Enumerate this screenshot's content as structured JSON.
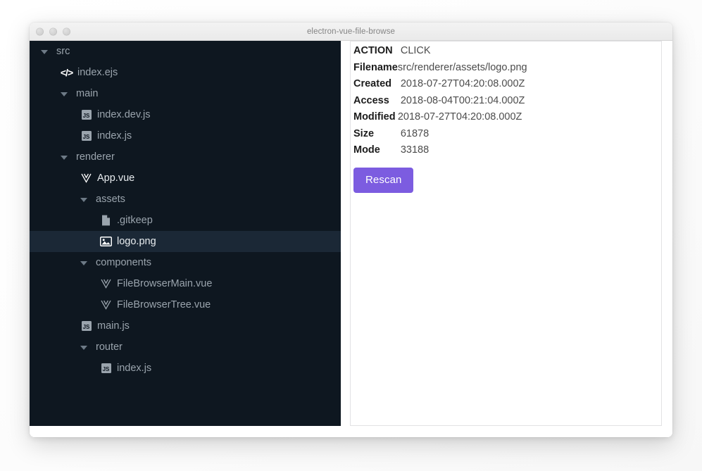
{
  "window": {
    "title": "electron-vue-file-browse",
    "traffic_lights": [
      "close-light",
      "minimize-light",
      "zoom-light"
    ]
  },
  "tree": {
    "items": [
      {
        "label": "src",
        "depth": 0,
        "caret": true,
        "icon": "none",
        "selected": false,
        "bright": false
      },
      {
        "label": "index.ejs",
        "depth": 1,
        "caret": false,
        "icon": "code",
        "selected": false,
        "bright": false
      },
      {
        "label": "main",
        "depth": 1,
        "caret": true,
        "icon": "none",
        "selected": false,
        "bright": false
      },
      {
        "label": "index.dev.js",
        "depth": 2,
        "caret": false,
        "icon": "js",
        "selected": false,
        "bright": false
      },
      {
        "label": "index.js",
        "depth": 2,
        "caret": false,
        "icon": "js",
        "selected": false,
        "bright": false
      },
      {
        "label": "renderer",
        "depth": 1,
        "caret": true,
        "icon": "none",
        "selected": false,
        "bright": false
      },
      {
        "label": "App.vue",
        "depth": 2,
        "caret": false,
        "icon": "vue-white",
        "selected": false,
        "bright": true
      },
      {
        "label": "assets",
        "depth": 2,
        "caret": true,
        "icon": "none",
        "selected": false,
        "bright": false
      },
      {
        "label": ".gitkeep",
        "depth": 3,
        "caret": false,
        "icon": "doc",
        "selected": false,
        "bright": false
      },
      {
        "label": "logo.png",
        "depth": 3,
        "caret": false,
        "icon": "image",
        "selected": true,
        "bright": true
      },
      {
        "label": "components",
        "depth": 2,
        "caret": true,
        "icon": "none",
        "selected": false,
        "bright": false
      },
      {
        "label": "FileBrowserMain.vue",
        "depth": 3,
        "caret": false,
        "icon": "vue-grey",
        "selected": false,
        "bright": false
      },
      {
        "label": "FileBrowserTree.vue",
        "depth": 3,
        "caret": false,
        "icon": "vue-grey",
        "selected": false,
        "bright": false
      },
      {
        "label": "main.js",
        "depth": 2,
        "caret": false,
        "icon": "js",
        "selected": false,
        "bright": false
      },
      {
        "label": "router",
        "depth": 2,
        "caret": true,
        "icon": "none",
        "selected": false,
        "bright": false
      },
      {
        "label": "index.js",
        "depth": 3,
        "caret": false,
        "icon": "js",
        "selected": false,
        "bright": false
      }
    ]
  },
  "details": {
    "rows": [
      {
        "key": "ACTION",
        "value": "CLICK",
        "pad": true
      },
      {
        "key": "Filename",
        "value": "src/renderer/assets/logo.png",
        "pad": false
      },
      {
        "key": "Created",
        "value": "2018-07-27T04:20:08.000Z",
        "pad": true
      },
      {
        "key": "Access",
        "value": "2018-08-04T00:21:04.000Z",
        "pad": true
      },
      {
        "key": "Modified",
        "value": "2018-07-27T04:20:08.000Z",
        "pad": false
      },
      {
        "key": "Size",
        "value": "61878",
        "pad": true
      },
      {
        "key": "Mode",
        "value": "33188",
        "pad": true
      }
    ],
    "rescan_label": "Rescan"
  },
  "colors": {
    "tree_background": "#0e1720",
    "tree_selected": "#1b2836",
    "tree_text": "#9aa4ad",
    "tree_text_bright": "#e8ecef",
    "accent_button": "#7c5ce0",
    "titlebar": "#eeeeee",
    "detail_key": "#1c1c1c",
    "detail_value": "#4c4c4c"
  }
}
